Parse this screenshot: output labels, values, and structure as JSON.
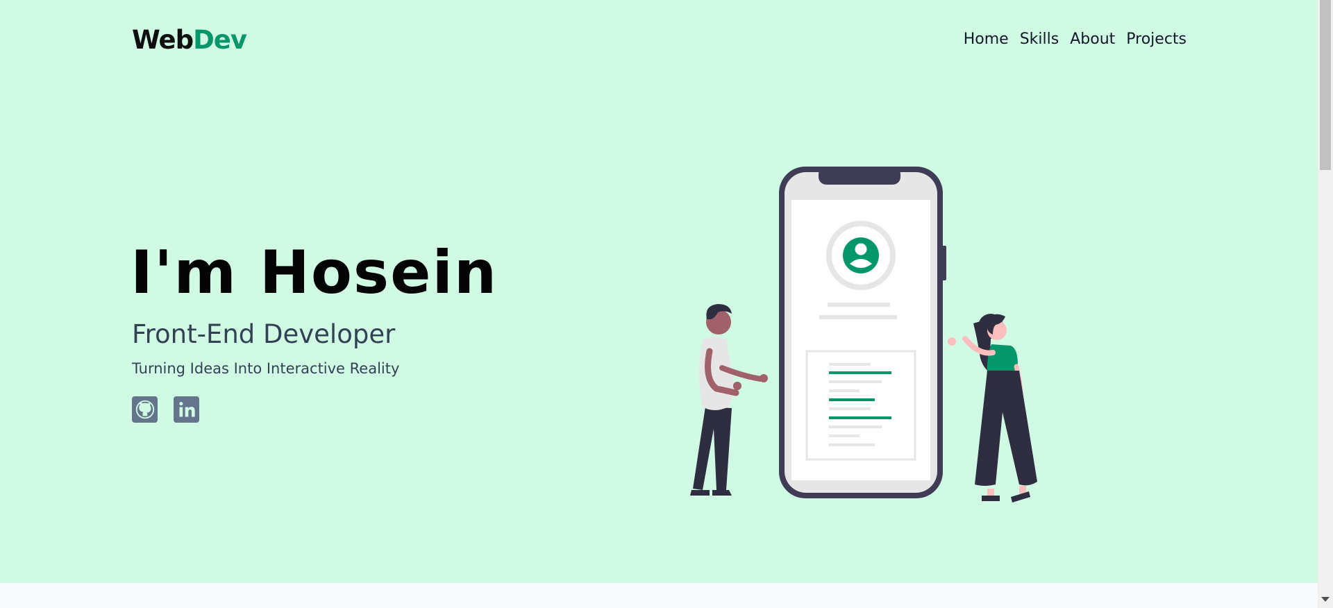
{
  "header": {
    "logo_main": "Web",
    "logo_accent": "Dev",
    "nav": [
      "Home",
      "Skills",
      "About",
      "Projects"
    ]
  },
  "hero": {
    "title": "I'm Hosein",
    "role": "Front-End Developer",
    "tagline": "Turning Ideas Into Interactive Reality"
  },
  "socials": [
    {
      "icon": "github-icon"
    },
    {
      "icon": "linkedin-icon"
    }
  ],
  "colors": {
    "background": "#d1fae5",
    "accent": "#059669",
    "text": "#050505",
    "muted": "#334155",
    "social_bg": "#64748b",
    "illustration_dark": "#2f2e41"
  }
}
